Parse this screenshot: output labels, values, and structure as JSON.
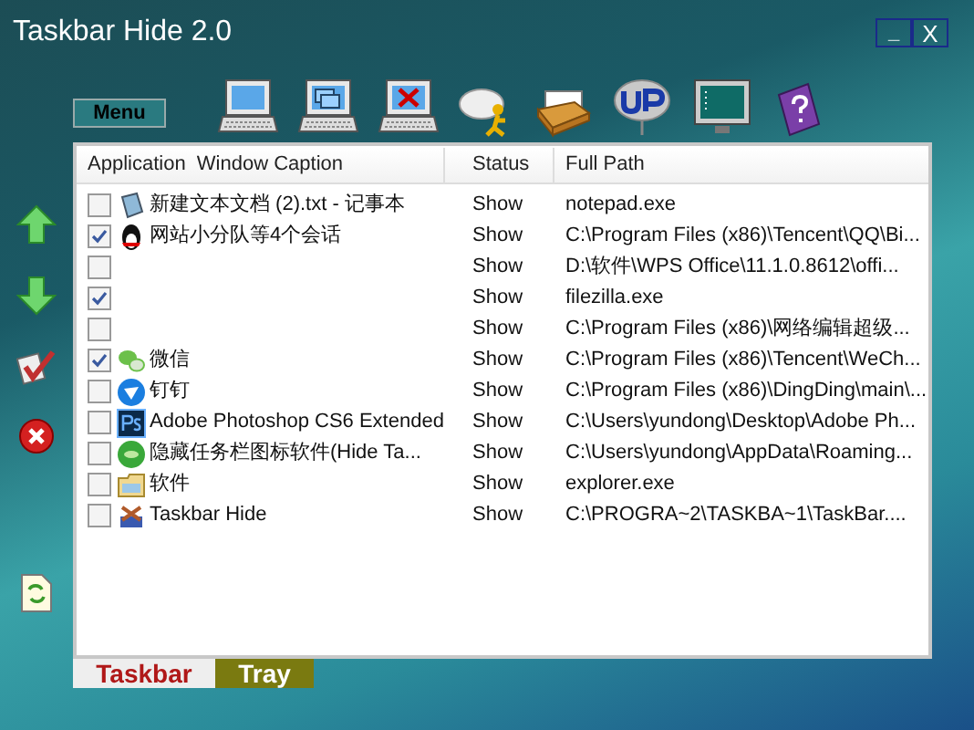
{
  "window": {
    "title": "Taskbar Hide 2.0",
    "controls": [
      "_",
      "X"
    ]
  },
  "menu_button": "Menu",
  "table": {
    "columns": [
      "Application  Window Caption",
      "Status",
      "Full Path"
    ],
    "rows": [
      {
        "kind": "notepad",
        "checked": false,
        "caption": "新建文本文档 (2).txt - 记事本",
        "status": "Show",
        "path": "notepad.exe"
      },
      {
        "kind": "qq",
        "checked": true,
        "caption": "网站小分队等4个会话",
        "status": "Show",
        "path": "C:\\Program Files (x86)\\Tencent\\QQ\\Bi..."
      },
      {
        "kind": "none",
        "checked": false,
        "status": "Show",
        "path": "D:\\软件\\WPS Office\\11.1.0.8612\\offi..."
      },
      {
        "kind": "none",
        "checked": true,
        "status": "Show",
        "path": "filezilla.exe"
      },
      {
        "kind": "none",
        "checked": false,
        "status": "Show",
        "path": "C:\\Program Files (x86)\\网络编辑超级..."
      },
      {
        "kind": "wechat",
        "checked": true,
        "caption": "微信",
        "status": "Show",
        "path": "C:\\Program Files (x86)\\Tencent\\WeCh..."
      },
      {
        "kind": "dingtalk",
        "checked": false,
        "caption": "钉钉",
        "status": "Show",
        "path": "C:\\Program Files (x86)\\DingDing\\main\\..."
      },
      {
        "kind": "photoshop",
        "checked": false,
        "caption": "Adobe Photoshop CS6 Extended",
        "status": "Show",
        "path": "C:\\Users\\yundong\\Desktop\\Adobe Ph..."
      },
      {
        "kind": "greenball",
        "checked": false,
        "caption": "隐藏任务栏图标软件(Hide Ta...",
        "status": "Show",
        "path": "C:\\Users\\yundong\\AppData\\Roaming..."
      },
      {
        "kind": "folder",
        "checked": false,
        "caption": "软件",
        "status": "Show",
        "path": "explorer.exe"
      },
      {
        "kind": "taskbar",
        "checked": false,
        "caption": "Taskbar Hide",
        "status": "Show",
        "path": "C:\\PROGRA~2\\TASKBA~1\\TaskBar...."
      }
    ]
  },
  "bottom_tabs": [
    {
      "label": "Taskbar",
      "selected": true
    },
    {
      "label": "Tray",
      "selected": false
    }
  ]
}
